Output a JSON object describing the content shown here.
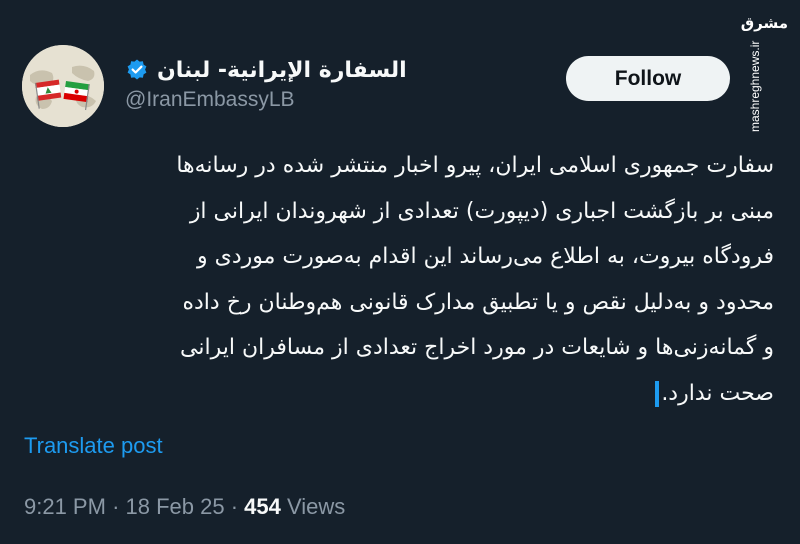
{
  "tweet": {
    "display_name": "السفارة الإيرانية- لبنان",
    "handle": "@IranEmbassyLB",
    "verified_badge": "verified-badge-icon",
    "follow_label": "Follow",
    "body_lines": [
      "سفارت جمهوری اسلامی ایران، پیرو اخبار منتشر شده در رسانه‌ها",
      "مبنی بر بازگشت اجباری (دیپورت) تعدادی از شهروندان ایرانی از",
      "فرودگاه بیروت، به اطلاع می‌رساند این اقدام به‌صورت موردی و",
      "محدود و به‌دلیل نقص و یا تطبیق مدارک قانونی هم‌وطنان رخ داده",
      "و گمانه‌زنی‌ها و شایعات در مورد اخراج تعدادی از مسافران ایرانی",
      "صحت ندارد."
    ],
    "translate_label": "Translate post",
    "time": "9:21 PM",
    "date": "18 Feb 25",
    "separator": "·",
    "views_count": "454",
    "views_label": "Views"
  },
  "watermark": {
    "logo_text": "مشرق",
    "url": "mashreghnews.ir"
  },
  "colors": {
    "background": "#15202b",
    "text_primary": "#f7f9f9",
    "text_secondary": "#8b98a5",
    "accent": "#1d9bf0",
    "follow_bg": "#eff3f4"
  }
}
